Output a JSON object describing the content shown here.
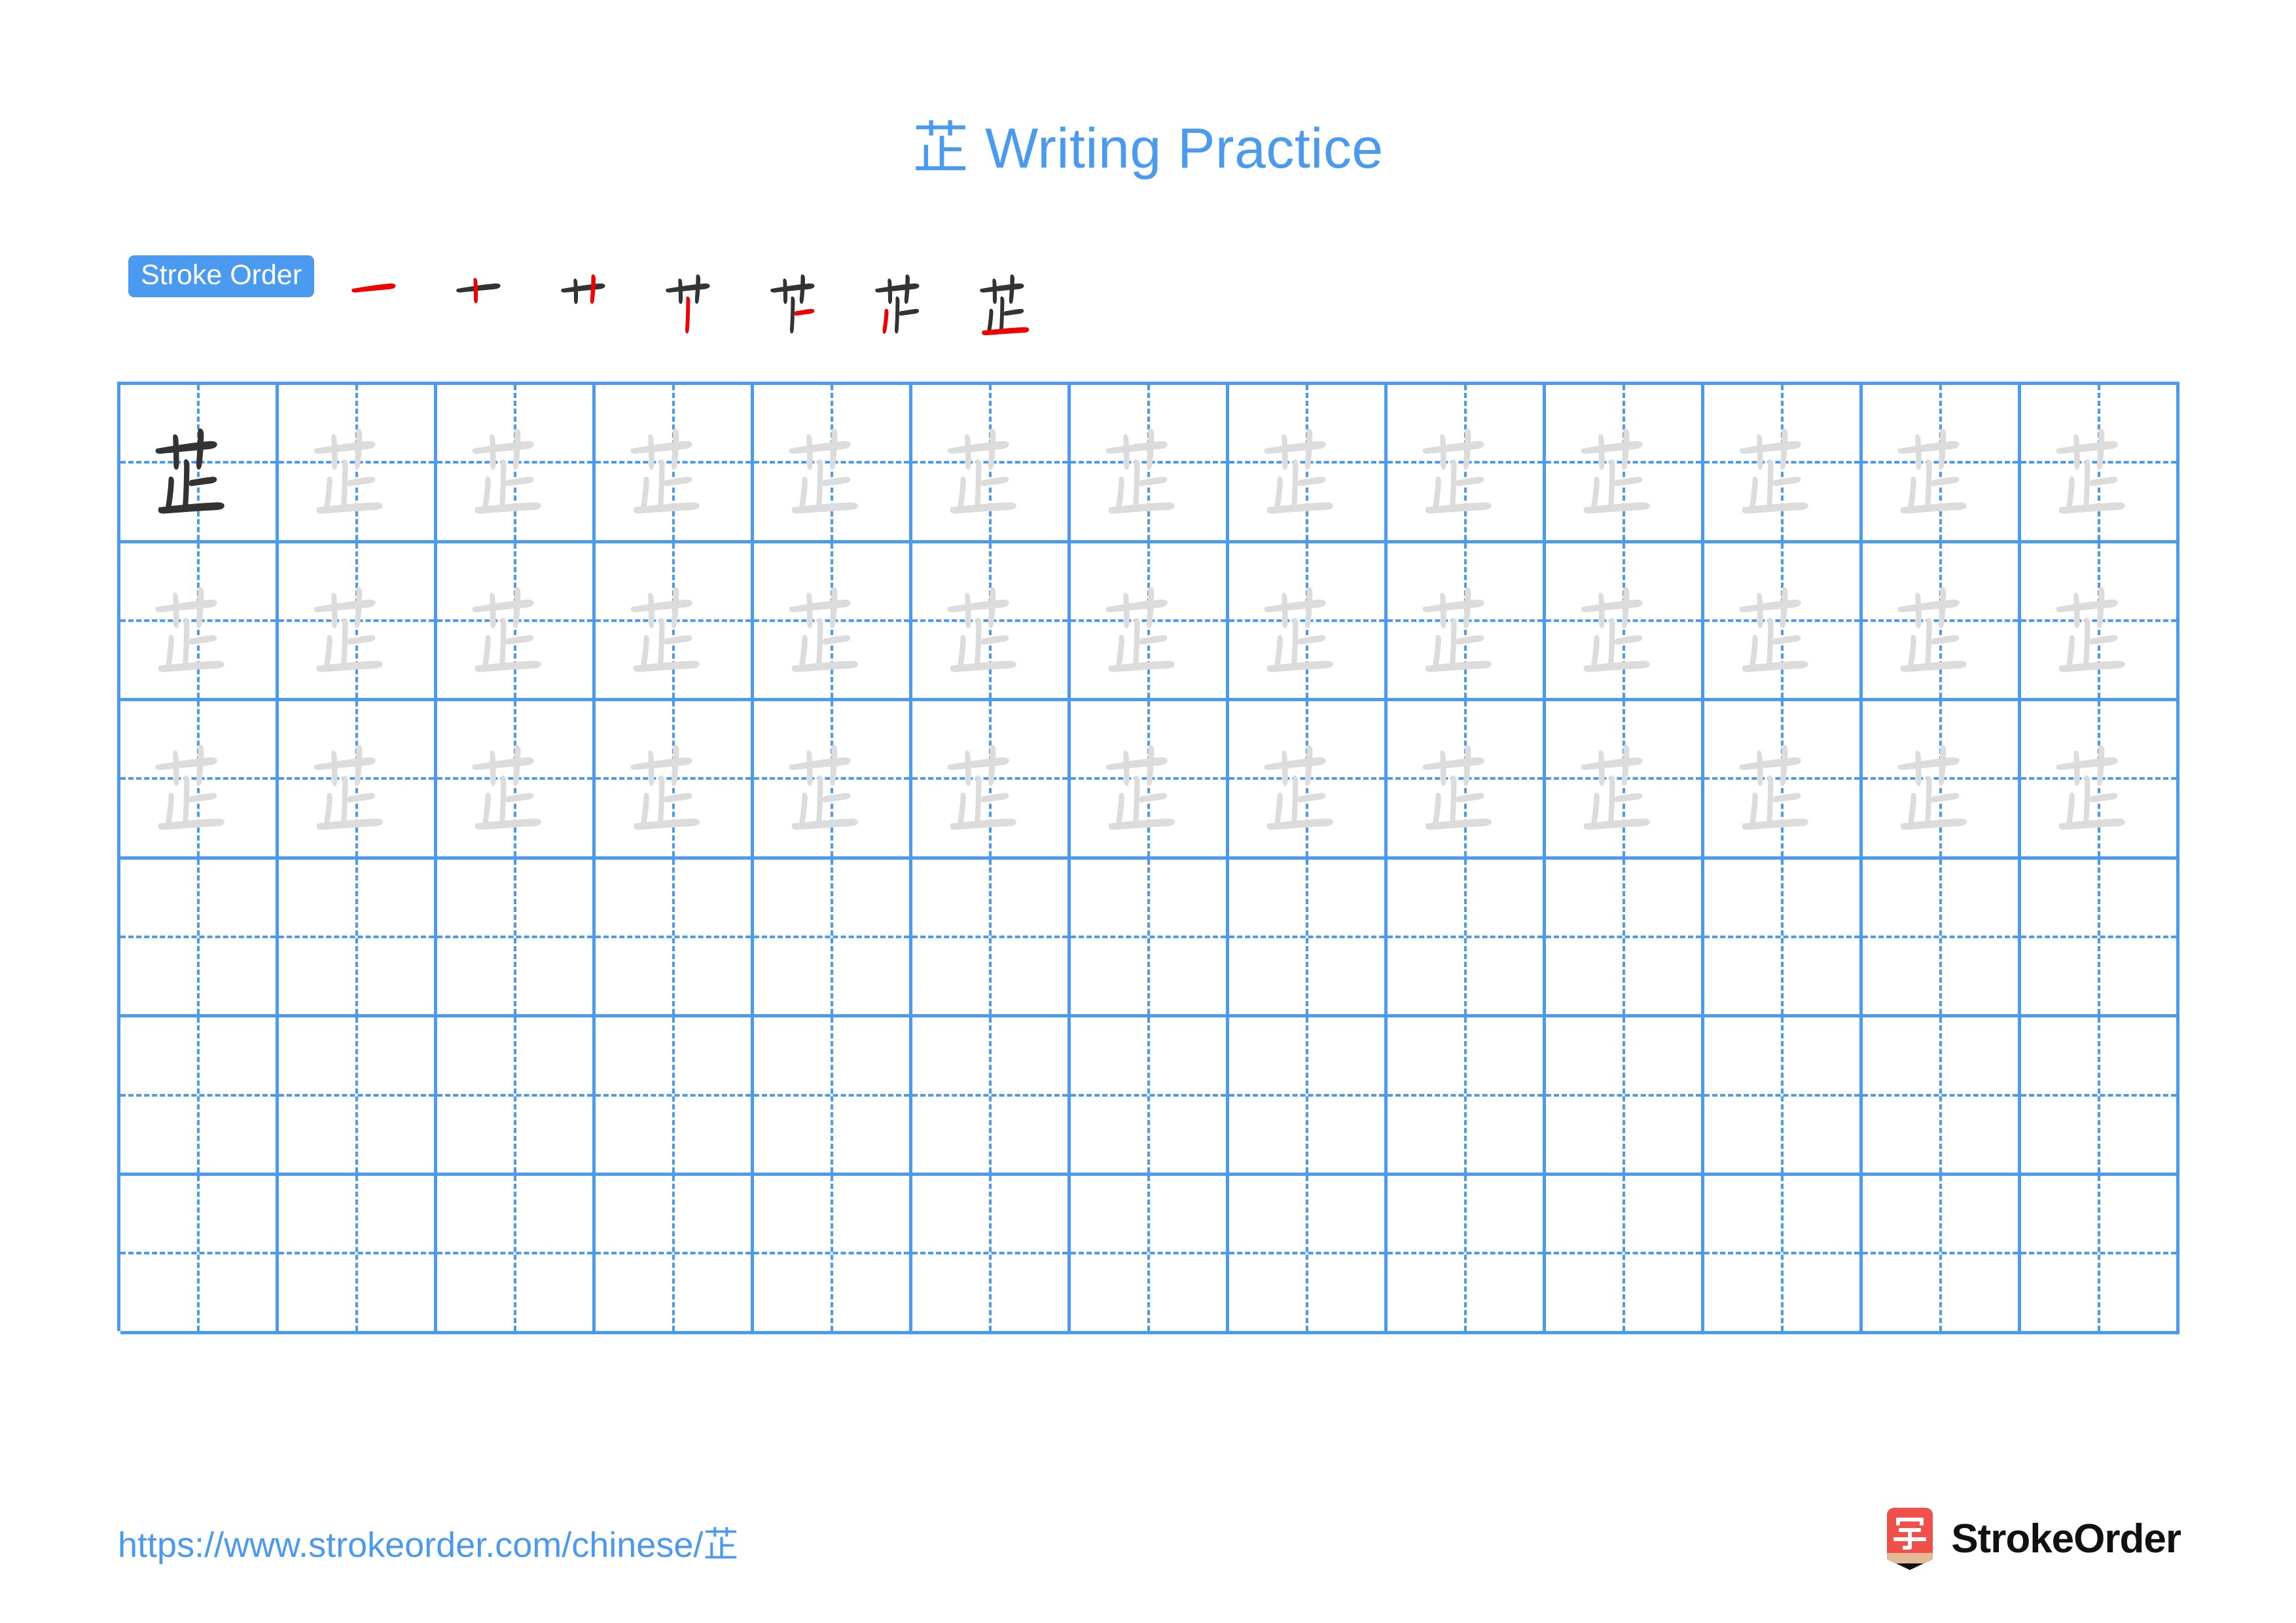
{
  "document": {
    "character": "芷",
    "title": "芷 Writing Practice",
    "page_background": "#ffffff"
  },
  "colors": {
    "accent_blue": "#4a9bef",
    "grid_line": "#4a9bef",
    "guide_line": "#4a9bef",
    "ink_dark": "#333333",
    "ink_trace": "#dcdcdc",
    "new_stroke_red": "#f00000",
    "logo_red": "#f1504a",
    "brand_text": "#111111"
  },
  "stroke_order": {
    "badge_label": "Stroke Order",
    "total_strokes": 7,
    "steps": [
      {
        "index": 1,
        "cumulative_glyph": "一",
        "new_stroke_name": "heng"
      },
      {
        "index": 2,
        "cumulative_glyph": "十",
        "new_stroke_name": "shu"
      },
      {
        "index": 3,
        "cumulative_glyph": "艹",
        "new_stroke_name": "shu"
      },
      {
        "index": 4,
        "cumulative_glyph": "艹丨",
        "new_stroke_name": "shu"
      },
      {
        "index": 5,
        "cumulative_glyph": "芉",
        "new_stroke_name": "heng"
      },
      {
        "index": 6,
        "cumulative_glyph": "芷-partial",
        "new_stroke_name": "shu"
      },
      {
        "index": 7,
        "cumulative_glyph": "芷",
        "new_stroke_name": "heng"
      }
    ]
  },
  "practice_grid": {
    "columns": 13,
    "rows": 6,
    "model_cell": {
      "row": 1,
      "column": 1,
      "style": "dark"
    },
    "trace_rows": [
      1,
      2,
      3
    ],
    "blank_rows": [
      4,
      5,
      6
    ],
    "cell_character": "芷",
    "guides": "crosshair-dashed"
  },
  "footer": {
    "url": "https://www.strokeorder.com/chinese/芷",
    "brand_name": "StrokeOrder",
    "logo_glyph": "字"
  }
}
